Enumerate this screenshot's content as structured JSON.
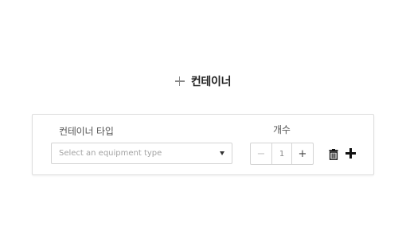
{
  "header": {
    "add_icon": "plus-icon",
    "title": "컨테이너"
  },
  "container_row": {
    "type_label": "컨테이너 타입",
    "type_select": {
      "placeholder": "Select an equipment type",
      "selected_value": ""
    },
    "count_label": "개수",
    "quantity": {
      "decrement": "−",
      "value": "1",
      "increment": "+"
    },
    "actions": {
      "delete_icon": "trash-icon",
      "add_icon": "plus-icon"
    }
  },
  "colors": {
    "text_primary": "#222222",
    "text_label": "#555555",
    "border": "#d4d4d4",
    "placeholder": "#a3a3a3"
  }
}
